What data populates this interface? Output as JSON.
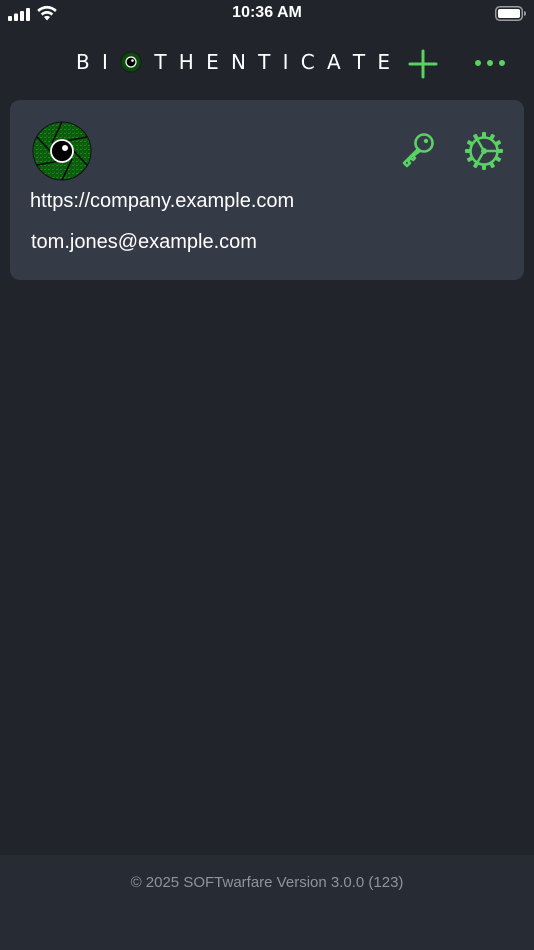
{
  "status_bar": {
    "time": "10:36 AM"
  },
  "header": {
    "logo_text_before": [
      "B",
      "I"
    ],
    "logo_text_after": [
      "T",
      "H",
      "E",
      "N",
      "T",
      "I",
      "C",
      "A",
      "T",
      "E"
    ],
    "add_icon": "plus-icon",
    "more_icon": "more-horizontal-icon"
  },
  "accounts": [
    {
      "url": "https://company.example.com",
      "email": "tom.jones@example.com",
      "key_icon": "key-icon",
      "settings_icon": "gear-icon"
    }
  ],
  "footer": {
    "text": "© 2025 SOFTwarfare Version 3.0.0 (123)"
  },
  "colors": {
    "background": "#21242b",
    "card": "#343b47",
    "accent": "#5ad163",
    "footer_bg": "#272b33",
    "footer_text": "#8e939c"
  }
}
